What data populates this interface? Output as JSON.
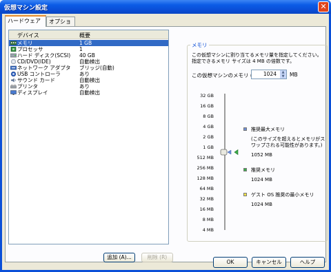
{
  "window": {
    "title": "仮想マシン設定",
    "close_glyph": "✕"
  },
  "tabs": [
    {
      "label": "ハードウェア",
      "active": true
    },
    {
      "label": "オプション",
      "active": false
    }
  ],
  "device_list": {
    "headers": [
      "デバイス",
      "概要"
    ],
    "rows": [
      {
        "icon": "memory-icon",
        "name": "メモリ",
        "value": "1 GB",
        "selected": true
      },
      {
        "icon": "processor-icon",
        "name": "プロセッサ",
        "value": "1",
        "selected": false
      },
      {
        "icon": "hard-disk-icon",
        "name": "ハード ディスク(SCSI)",
        "value": "40 GB",
        "selected": false
      },
      {
        "icon": "cd-dvd-icon",
        "name": "CD/DVD(IDE)",
        "value": "自動検出",
        "selected": false
      },
      {
        "icon": "network-adapter-icon",
        "name": "ネットワーク アダプタ",
        "value": "ブリッジ(自動)",
        "selected": false
      },
      {
        "icon": "usb-controller-icon",
        "name": "USB コントローラ",
        "value": "あり",
        "selected": false
      },
      {
        "icon": "sound-card-icon",
        "name": "サウンド カード",
        "value": "自動検出",
        "selected": false
      },
      {
        "icon": "printer-icon",
        "name": "プリンタ",
        "value": "あり",
        "selected": false
      },
      {
        "icon": "display-icon",
        "name": "ディスプレイ",
        "value": "自動検出",
        "selected": false
      }
    ]
  },
  "buttons": {
    "add": "追加 (A)...",
    "remove": "削除 (R)"
  },
  "memory": {
    "legend": "メモリ",
    "description": "この仮想マシンに割り当てるメモリ量を指定してください。指定できるメモリ サイズは 4 MB の倍数です。",
    "field_label": "この仮想マシンのメモリ (M):",
    "value": "1024",
    "unit": "MB",
    "scale": [
      "32 GB",
      "16 GB",
      "8 GB",
      "4 GB",
      "2 GB",
      "1 GB",
      "512 MB",
      "256 MB",
      "128 MB",
      "64 MB",
      "32 MB",
      "16 MB",
      "8 MB",
      "4 MB"
    ],
    "current_label": "1 GB",
    "recommended_max": {
      "title": "推奨最大メモリ",
      "note": "(このサイズを超えるとメモリがスワップされる可能性があります。)",
      "value": "1052 MB",
      "color": "#6f8fd6"
    },
    "recommended": {
      "title": "推奨メモリ",
      "value": "1024 MB",
      "color": "#3cb04a"
    },
    "guest_min": {
      "title": "ゲスト OS 推奨の最小メモリ",
      "value": "1024 MB",
      "color": "#f2e24a"
    }
  },
  "footer": {
    "ok": "OK",
    "cancel": "キャンセル",
    "help": "ヘルプ"
  }
}
